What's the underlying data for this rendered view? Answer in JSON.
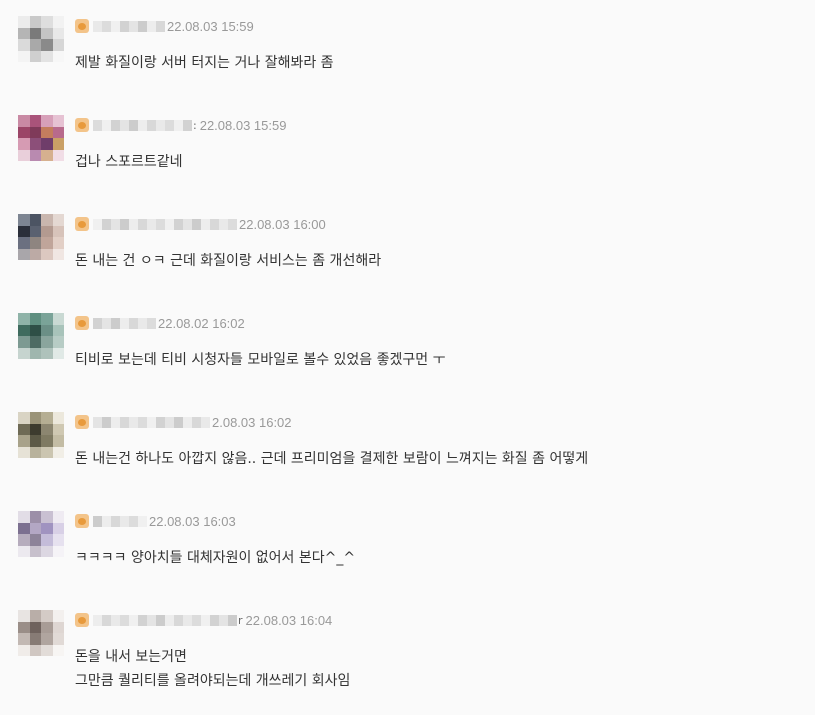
{
  "comments": [
    {
      "avatar": [
        "#ececec",
        "#c9c9c9",
        "#dedede",
        "#f2f2f2",
        "#b5b5b5",
        "#7a7a7a",
        "#c4c4c4",
        "#e8e8e8",
        "#dadada",
        "#a9a9a9",
        "#8a8a8a",
        "#d6d6d6",
        "#f4f4f4",
        "#cfcfcf",
        "#e3e3e3",
        "#f7f7f7"
      ],
      "nick_tail": "",
      "date": "22.08.03 15:59",
      "lines": [
        "제발 화질이랑 서버 터지는 거나 잘해봐라 좀"
      ]
    },
    {
      "avatar": [
        "#c98aa4",
        "#a9537a",
        "#d7a0b9",
        "#e6c2d3",
        "#9b4567",
        "#7f3a5a",
        "#c47d5e",
        "#b86a8c",
        "#d69bb3",
        "#8c4f79",
        "#6f3d6a",
        "#caa066",
        "#e9cfda",
        "#b98ab0",
        "#d6b08f",
        "#f1dde6"
      ],
      "nick_tail": ":",
      "date": "22.08.03 15:59",
      "lines": [
        "겁나 스포르트같네"
      ]
    },
    {
      "avatar": [
        "#7d8592",
        "#4c5463",
        "#c9b6ae",
        "#e4d8d2",
        "#2b2f3a",
        "#5a6170",
        "#b39a90",
        "#d7c3ba",
        "#6b7080",
        "#8e8580",
        "#c0a59a",
        "#e2cfc6",
        "#a9a6aa",
        "#bcaaa5",
        "#dcc8c0",
        "#f0e6e2"
      ],
      "nick_tail": "",
      "date": "22.08.03 16:00",
      "lines": [
        "돈 내는 건 ㅇㅋ 근데 화질이랑 서비스는 좀 개선해라"
      ]
    },
    {
      "avatar": [
        "#8fb3a8",
        "#5f8f80",
        "#7aa398",
        "#c9d9d3",
        "#3f6b5e",
        "#2e4f46",
        "#6b8f86",
        "#a8c3ba",
        "#7d9a92",
        "#4d6b63",
        "#8aa59d",
        "#b7ccc5",
        "#c6d4cf",
        "#9fb6ae",
        "#aec2bb",
        "#e0e9e6"
      ],
      "nick_tail": "",
      "date": "22.08.02 16:02",
      "lines": [
        "티비로 보는데 티비 시청자들 모바일로 볼수 있었음 좋겠구먼 ㅜ"
      ]
    },
    {
      "avatar": [
        "#d9d4c4",
        "#9a9378",
        "#b5ae93",
        "#ece8dc",
        "#6e6a55",
        "#3d3b2e",
        "#8c8670",
        "#cfc8b2",
        "#a8a28a",
        "#5c5946",
        "#7f7a62",
        "#c3bca4",
        "#e6e2d6",
        "#b8b29c",
        "#cbc5b0",
        "#f1eee6"
      ],
      "nick_tail": "",
      "date": "2.08.03 16:02",
      "lines": [
        "돈 내는건 하나도 아깝지 않음.. 근데 프리미엄을 결제한 보람이 느껴지는 화질 좀 어떻게"
      ]
    },
    {
      "avatar": [
        "#e2dde6",
        "#9c8fa8",
        "#c9c0d2",
        "#efebf2",
        "#7c7090",
        "#b3a7c4",
        "#a093c0",
        "#d8d0e6",
        "#b6acbd",
        "#8d8399",
        "#c4bcd9",
        "#e6e1ef",
        "#ece9ef",
        "#c7c0cc",
        "#dcd7e2",
        "#f5f3f7"
      ],
      "nick_tail": "",
      "date": "22.08.03 16:03",
      "lines": [
        "ㅋㅋㅋㅋ 양아치들 대체자원이 없어서 본다^_^"
      ]
    },
    {
      "avatar": [
        "#e8e4e2",
        "#b9aea8",
        "#d4cbc6",
        "#f3f0ee",
        "#9a8e88",
        "#6f625d",
        "#a89c96",
        "#ded6d2",
        "#c2b8b3",
        "#877b75",
        "#b0a59f",
        "#e1dad6",
        "#f0ece9",
        "#d0c7c2",
        "#e2dcd8",
        "#f7f5f3"
      ],
      "nick_tail": "r",
      "date": "22.08.03 16:04",
      "lines": [
        "돈을 내서 보는거면",
        "그만큼 퀄리티를 올려야되는데 개쓰레기 회사임"
      ]
    }
  ]
}
